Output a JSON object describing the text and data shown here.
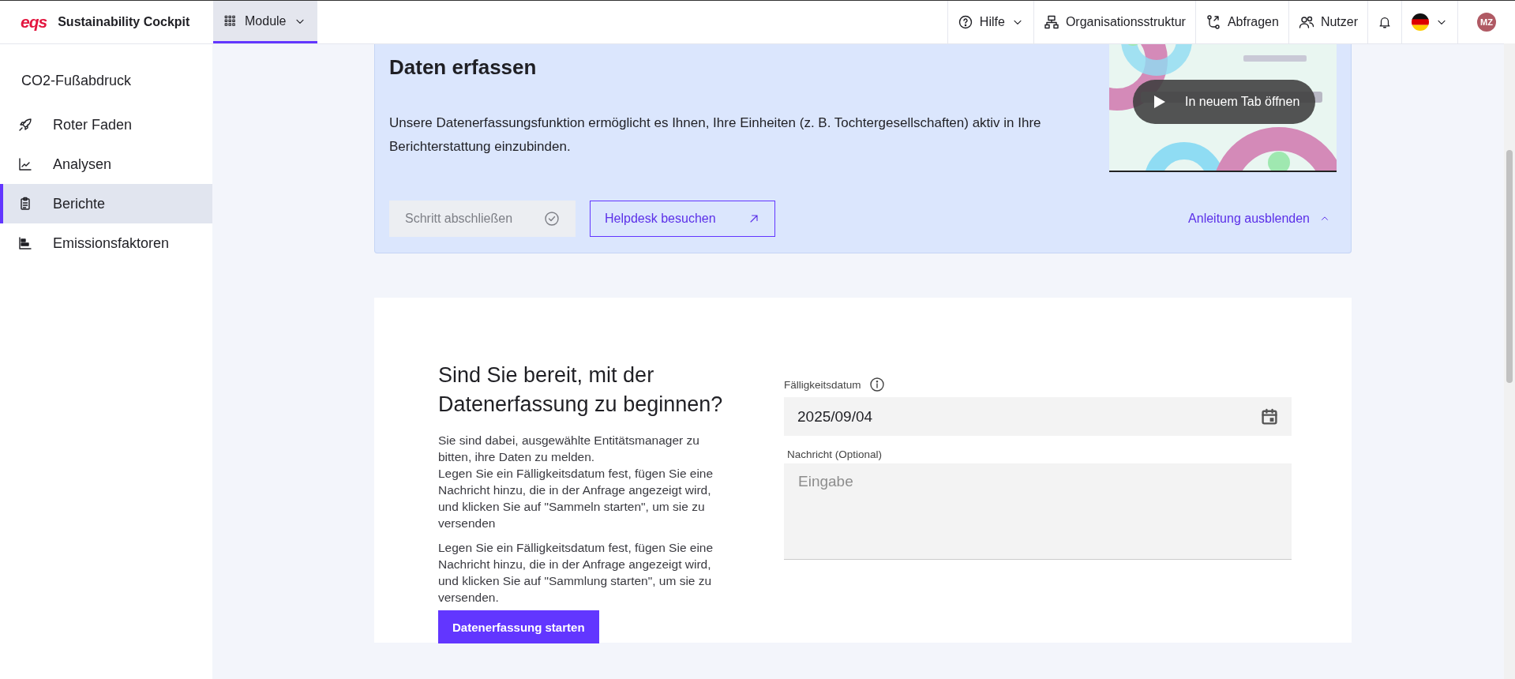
{
  "topbar": {
    "logo": "eqs",
    "app_title": "Sustainability Cockpit",
    "module_tab": {
      "label": "Module",
      "selected": true
    },
    "nav": [
      {
        "kind": "help",
        "label": "Hilfe"
      },
      {
        "kind": "org",
        "label": "Organisationsstruktur"
      },
      {
        "kind": "queries",
        "label": "Abfragen"
      },
      {
        "kind": "users",
        "label": "Nutzer"
      }
    ],
    "avatar": "MZ"
  },
  "sidebar": {
    "title": "CO2-Fußabdruck",
    "items": [
      {
        "kind": "rocket",
        "label": "Roter Faden",
        "selected": false
      },
      {
        "kind": "chart",
        "label": "Analysen",
        "selected": false
      },
      {
        "kind": "clipboard",
        "label": "Berichte",
        "selected": true
      },
      {
        "kind": "factors",
        "label": "Emissionsfaktoren",
        "selected": false
      }
    ]
  },
  "guide": {
    "title": "Daten erfassen",
    "text": "Unsere Datenerfassungsfunktion ermöglicht es Ihnen, Ihre Einheiten (z. B. Tochtergesellschaften) aktiv in Ihre Berichterstattung einzubinden.",
    "complete_button": {
      "label": "Schritt abschließen",
      "disabled": true
    },
    "helpdesk_button": "Helpdesk besuchen",
    "hide_link": "Anleitung ausblenden",
    "video": {
      "kind": "picture",
      "button": "In neuem Tab öffnen"
    }
  },
  "start": {
    "heading": "Sind Sie bereit, mit der Datenerfassung zu beginnen?",
    "paragraphs": [
      "Sie sind dabei, ausgewählte Entitätsmanager zu bitten, ihre Daten zu melden.\nLegen Sie ein Fälligkeitsdatum fest, fügen Sie eine Nachricht hinzu, die in der Anfrage angezeigt wird, und klicken Sie auf \"Sammeln starten\", um sie zu versenden",
      "Legen Sie ein Fälligkeitsdatum fest, fügen Sie eine Nachricht hinzu, die in der Anfrage angezeigt wird, und klicken Sie auf \"Sammlung starten\", um sie zu versenden."
    ],
    "due_date": {
      "label": "Fälligkeitsdatum",
      "value": "2025/09/04"
    },
    "message": {
      "label": "Nachricht (Optional)",
      "placeholder": "Eingabe"
    },
    "button": "Datenerfassung starten"
  }
}
